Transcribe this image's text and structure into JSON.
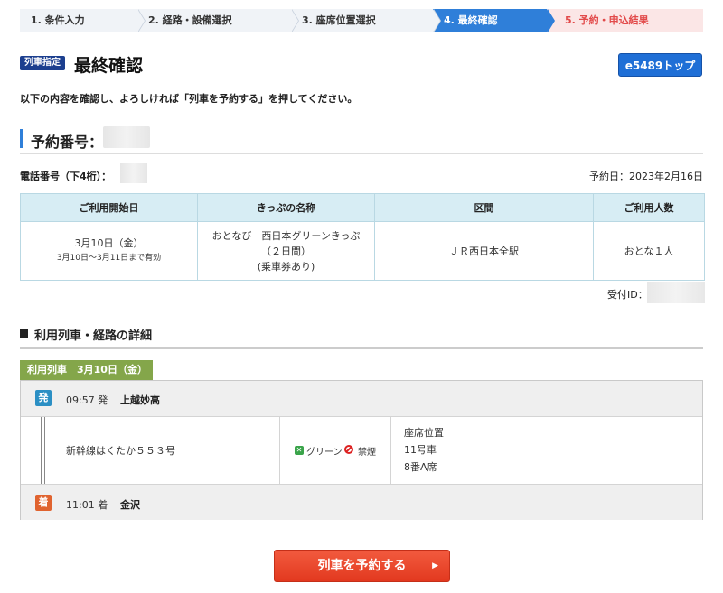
{
  "steps": [
    {
      "label": "1. 条件入力"
    },
    {
      "label": "2. 経路・設備選択"
    },
    {
      "label": "3. 座席位置選択"
    },
    {
      "label": "4. 最終確認"
    },
    {
      "label": "5. 予約・申込結果"
    }
  ],
  "header": {
    "badge": "列車指定",
    "title": "最終確認",
    "top_button": "e5489トップ"
  },
  "instruction": "以下の内容を確認し、よろしければ「列車を予約する」を押してください。",
  "reservation": {
    "number_label": "予約番号：",
    "phone_label": "電話番号（下4桁）：",
    "reserved_date": "予約日：2023年2月16日",
    "receipt_label": "受付ID："
  },
  "ticket_table": {
    "headers": [
      "ご利用開始日",
      "きっぷの名称",
      "区間",
      "ご利用人数"
    ],
    "start_date": "3月10日（金）",
    "valid_range": "3月10日～3月11日まで有効",
    "ticket_name_1": "おとなび　西日本グリーンきっぷ",
    "ticket_name_2": "（２日間）",
    "ticket_name_3": "(乗車券あり)",
    "section": "ＪＲ西日本全駅",
    "passengers": "おとな１人"
  },
  "route": {
    "section_title": "利用列車・経路の詳細",
    "tab_label": "利用列車　3月10日（金）",
    "departure": {
      "icon": "発",
      "time": "09:57 発",
      "station": "上越妙高"
    },
    "train_name": "新幹線はくたか５５３号",
    "green_label": "グリーン",
    "nosmoke_label": "禁煙",
    "seat_title": "座席位置",
    "car": "11号車",
    "seat": "8番A席",
    "arrival": {
      "icon": "着",
      "time": "11:01 着",
      "station": "金沢"
    }
  },
  "reserve_button": "列車を予約する",
  "colors": {
    "accent_blue": "#2f7fd9",
    "badge_navy": "#1c3f8f",
    "green_tab": "#84a64a",
    "reserve_red": "#e2391f",
    "table_header": "#d7edf4"
  }
}
